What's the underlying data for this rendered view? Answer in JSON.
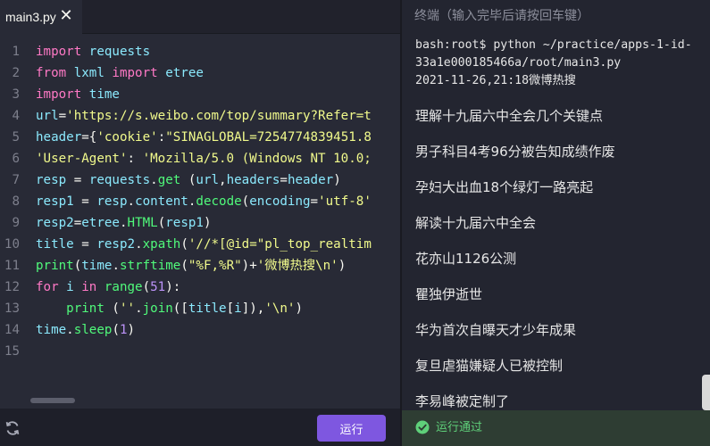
{
  "editor": {
    "tab": {
      "file_name": "main3.py",
      "close_symbol": "✕",
      "close_icon": "close-icon"
    },
    "lines": [
      {
        "n": "1",
        "tokens": [
          {
            "t": "import",
            "c": "kw"
          },
          {
            "t": " requests",
            "c": "mod"
          }
        ]
      },
      {
        "n": "2",
        "tokens": [
          {
            "t": "from",
            "c": "kw"
          },
          {
            "t": " lxml ",
            "c": "mod"
          },
          {
            "t": "import",
            "c": "kw"
          },
          {
            "t": " etree",
            "c": "mod"
          }
        ]
      },
      {
        "n": "3",
        "tokens": [
          {
            "t": "import",
            "c": "kw"
          },
          {
            "t": " time",
            "c": "mod"
          }
        ]
      },
      {
        "n": "4",
        "tokens": [
          {
            "t": "url",
            "c": "mod"
          },
          {
            "t": "=",
            "c": "pl"
          },
          {
            "t": "'https://s.weibo.com/top/summary?Refer=t",
            "c": "str"
          }
        ]
      },
      {
        "n": "5",
        "tokens": [
          {
            "t": "header",
            "c": "mod"
          },
          {
            "t": "={",
            "c": "pl"
          },
          {
            "t": "'cookie'",
            "c": "str"
          },
          {
            "t": ":",
            "c": "pl"
          },
          {
            "t": "\"SINAGLOBAL=7254774839451.8",
            "c": "str"
          }
        ]
      },
      {
        "n": "6",
        "tokens": [
          {
            "t": "'User-Agent'",
            "c": "str"
          },
          {
            "t": ": ",
            "c": "pl"
          },
          {
            "t": "'Mozilla/5.0 (Windows NT 10.0;",
            "c": "str"
          }
        ]
      },
      {
        "n": "7",
        "tokens": [
          {
            "t": "resp ",
            "c": "mod"
          },
          {
            "t": "= ",
            "c": "pl"
          },
          {
            "t": "requests",
            "c": "mod"
          },
          {
            "t": ".",
            "c": "pl"
          },
          {
            "t": "get",
            "c": "fn"
          },
          {
            "t": " (",
            "c": "pl"
          },
          {
            "t": "url",
            "c": "mod"
          },
          {
            "t": ",",
            "c": "pl"
          },
          {
            "t": "headers",
            "c": "mod"
          },
          {
            "t": "=",
            "c": "pl"
          },
          {
            "t": "header",
            "c": "mod"
          },
          {
            "t": ")",
            "c": "pl"
          }
        ]
      },
      {
        "n": "8",
        "tokens": [
          {
            "t": "resp1 ",
            "c": "mod"
          },
          {
            "t": "= ",
            "c": "pl"
          },
          {
            "t": "resp",
            "c": "mod"
          },
          {
            "t": ".",
            "c": "pl"
          },
          {
            "t": "content",
            "c": "mod"
          },
          {
            "t": ".",
            "c": "pl"
          },
          {
            "t": "decode",
            "c": "fn"
          },
          {
            "t": "(",
            "c": "pl"
          },
          {
            "t": "encoding",
            "c": "mod"
          },
          {
            "t": "=",
            "c": "pl"
          },
          {
            "t": "'utf-8'",
            "c": "str"
          }
        ]
      },
      {
        "n": "9",
        "tokens": [
          {
            "t": "resp2",
            "c": "mod"
          },
          {
            "t": "=",
            "c": "pl"
          },
          {
            "t": "etree",
            "c": "mod"
          },
          {
            "t": ".",
            "c": "pl"
          },
          {
            "t": "HTML",
            "c": "fn"
          },
          {
            "t": "(",
            "c": "pl"
          },
          {
            "t": "resp1",
            "c": "mod"
          },
          {
            "t": ")",
            "c": "pl"
          }
        ]
      },
      {
        "n": "10",
        "tokens": [
          {
            "t": "title ",
            "c": "mod"
          },
          {
            "t": "= ",
            "c": "pl"
          },
          {
            "t": "resp2",
            "c": "mod"
          },
          {
            "t": ".",
            "c": "pl"
          },
          {
            "t": "xpath",
            "c": "fn"
          },
          {
            "t": "(",
            "c": "pl"
          },
          {
            "t": "'//*[@id=\"pl_top_realtim",
            "c": "str"
          }
        ]
      },
      {
        "n": "11",
        "tokens": [
          {
            "t": "print",
            "c": "fn"
          },
          {
            "t": "(",
            "c": "pl"
          },
          {
            "t": "time",
            "c": "mod"
          },
          {
            "t": ".",
            "c": "pl"
          },
          {
            "t": "strftime",
            "c": "fn"
          },
          {
            "t": "(",
            "c": "pl"
          },
          {
            "t": "\"%F,%R\"",
            "c": "str"
          },
          {
            "t": ")+",
            "c": "pl"
          },
          {
            "t": "'微博热搜\\n'",
            "c": "str"
          },
          {
            "t": ")",
            "c": "pl"
          }
        ]
      },
      {
        "n": "12",
        "tokens": [
          {
            "t": "for",
            "c": "kw"
          },
          {
            "t": " i ",
            "c": "mod"
          },
          {
            "t": "in",
            "c": "kw"
          },
          {
            "t": " range",
            "c": "fn"
          },
          {
            "t": "(",
            "c": "pl"
          },
          {
            "t": "51",
            "c": "num"
          },
          {
            "t": "):",
            "c": "pl"
          }
        ]
      },
      {
        "n": "13",
        "tokens": [
          {
            "t": "    print",
            "c": "fn"
          },
          {
            "t": " (",
            "c": "pl"
          },
          {
            "t": "''",
            "c": "str"
          },
          {
            "t": ".",
            "c": "pl"
          },
          {
            "t": "join",
            "c": "fn"
          },
          {
            "t": "([",
            "c": "pl"
          },
          {
            "t": "title",
            "c": "mod"
          },
          {
            "t": "[",
            "c": "pl"
          },
          {
            "t": "i",
            "c": "mod"
          },
          {
            "t": "]),",
            "c": "pl"
          },
          {
            "t": "'\\n'",
            "c": "str"
          },
          {
            "t": ")",
            "c": "pl"
          }
        ]
      },
      {
        "n": "14",
        "tokens": [
          {
            "t": "time",
            "c": "mod"
          },
          {
            "t": ".",
            "c": "pl"
          },
          {
            "t": "sleep",
            "c": "fn"
          },
          {
            "t": "(",
            "c": "pl"
          },
          {
            "t": "1",
            "c": "num"
          },
          {
            "t": ")",
            "c": "pl"
          }
        ]
      },
      {
        "n": "15",
        "tokens": []
      }
    ],
    "reset_icon": "reset-icon",
    "run_label": "运行"
  },
  "terminal": {
    "title": "终端（输入完毕后请按回车键）",
    "command_lines": [
      "bash:root$ python ~/practice/apps-1-id-",
      "33a1e000185466a/root/main3.py",
      "2021-11-26,21:18微博热搜"
    ],
    "results": [
      "理解十九届六中全会几个关键点",
      "男子科目4考96分被告知成绩作废",
      "孕妇大出血18个绿灯一路亮起",
      "解读十九届六中全会",
      "花亦山1126公测",
      "瞿独伊逝世",
      "华为首次自曝天才少年成果",
      "复旦虐猫嫌疑人已被控制",
      "李易峰被定制了"
    ]
  },
  "status": {
    "icon": "check-circle-icon",
    "text": "运行通过",
    "color": "#5fd07a"
  },
  "colors": {
    "editor_bg": "#282a36",
    "terminal_bg": "#232530",
    "accent": "#7e57e0",
    "keyword": "#ff79c6",
    "string": "#f1fa8c",
    "function": "#50fa7b",
    "name": "#8be9fd"
  }
}
